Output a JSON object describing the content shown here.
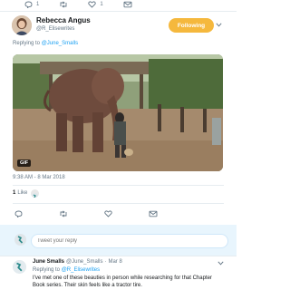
{
  "top_actions": {
    "reply_count": "1",
    "like_count": "1"
  },
  "tweet": {
    "author_name": "Rebecca Angus",
    "author_handle": "@R_Elisewrites",
    "follow_label": "Following",
    "replying_prefix": "Replying to",
    "replying_to": "@June_Smalls",
    "media_badge": "GIF",
    "timestamp": "9:38 AM - 8 Mar 2018",
    "likes_count": "1",
    "likes_label": "Like"
  },
  "reply_box": {
    "placeholder": "Tweet your reply"
  },
  "reply": {
    "author_name": "June Smalls",
    "author_handle": "@June_Smalls",
    "date": "Mar 8",
    "replying_prefix": "Replying to",
    "replying_to": "@R_Elisewrites",
    "text": "I've met one of these beauties in person while researching for that Chapter Book series. Their skin feels like a tractor tire."
  },
  "colors": {
    "accent": "#1da1f2",
    "follow": "#f5b83d",
    "muted": "#657786"
  }
}
